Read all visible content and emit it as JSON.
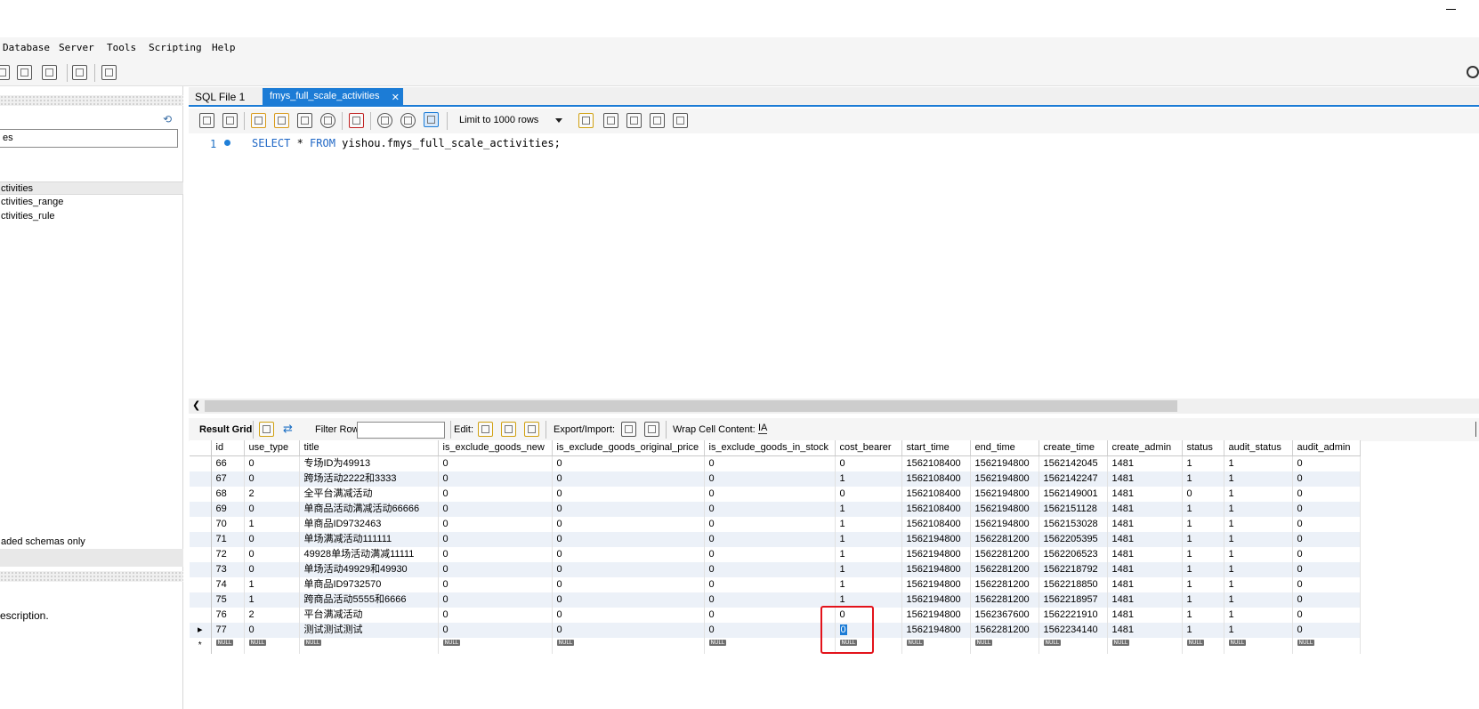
{
  "menu": [
    "Database",
    "Server",
    "Tools",
    "Scripting",
    "Help"
  ],
  "sidebar": {
    "filter_value": "es",
    "tables": [
      "ctivities",
      "ctivities_range",
      "ctivities_rule"
    ],
    "loaded_note": "aded schemas only",
    "description": "escription."
  },
  "tabs": [
    "SQL File 1",
    "fmys_full_scale_activities"
  ],
  "editor": {
    "line_number": "1",
    "sql_kw1": "SELECT",
    "sql_mid": " * ",
    "sql_kw2": "FROM",
    "sql_rest": " yishou.fmys_full_scale_activities;"
  },
  "toolbar": {
    "limit_label": "Limit to 1000 rows"
  },
  "result_toolbar": {
    "result_grid": "Result Grid",
    "filter_rows": "Filter Rows:",
    "edit": "Edit:",
    "export_import": "Export/Import:",
    "wrap": "Wrap Cell Content:"
  },
  "grid": {
    "columns": [
      "id",
      "use_type",
      "title",
      "is_exclude_goods_new",
      "is_exclude_goods_original_price",
      "is_exclude_goods_in_stock",
      "cost_bearer",
      "start_time",
      "end_time",
      "create_time",
      "create_admin",
      "status",
      "audit_status",
      "audit_admin"
    ],
    "rows": [
      [
        "66",
        "0",
        "专场ID为49913",
        "0",
        "0",
        "0",
        "0",
        "1562108400",
        "1562194800",
        "1562142045",
        "1481",
        "1",
        "1",
        "0"
      ],
      [
        "67",
        "0",
        "跨场活动2222和3333",
        "0",
        "0",
        "0",
        "1",
        "1562108400",
        "1562194800",
        "1562142247",
        "1481",
        "1",
        "1",
        "0"
      ],
      [
        "68",
        "2",
        "全平台满减活动",
        "0",
        "0",
        "0",
        "0",
        "1562108400",
        "1562194800",
        "1562149001",
        "1481",
        "0",
        "1",
        "0"
      ],
      [
        "69",
        "0",
        "单商品活动满减活动66666",
        "0",
        "0",
        "0",
        "1",
        "1562108400",
        "1562194800",
        "1562151128",
        "1481",
        "1",
        "1",
        "0"
      ],
      [
        "70",
        "1",
        "单商品ID9732463",
        "0",
        "0",
        "0",
        "1",
        "1562108400",
        "1562194800",
        "1562153028",
        "1481",
        "1",
        "1",
        "0"
      ],
      [
        "71",
        "0",
        "单场满减活动111111",
        "0",
        "0",
        "0",
        "1",
        "1562194800",
        "1562281200",
        "1562205395",
        "1481",
        "1",
        "1",
        "0"
      ],
      [
        "72",
        "0",
        "49928单场活动满减11111",
        "0",
        "0",
        "0",
        "1",
        "1562194800",
        "1562281200",
        "1562206523",
        "1481",
        "1",
        "1",
        "0"
      ],
      [
        "73",
        "0",
        "单场活动49929和49930",
        "0",
        "0",
        "0",
        "1",
        "1562194800",
        "1562281200",
        "1562218792",
        "1481",
        "1",
        "1",
        "0"
      ],
      [
        "74",
        "1",
        "单商品ID9732570",
        "0",
        "0",
        "0",
        "1",
        "1562194800",
        "1562281200",
        "1562218850",
        "1481",
        "1",
        "1",
        "0"
      ],
      [
        "75",
        "1",
        "跨商品活动5555和6666",
        "0",
        "0",
        "0",
        "1",
        "1562194800",
        "1562281200",
        "1562218957",
        "1481",
        "1",
        "1",
        "0"
      ],
      [
        "76",
        "2",
        "平台满减活动",
        "0",
        "0",
        "0",
        "0",
        "1562194800",
        "1562367600",
        "1562221910",
        "1481",
        "1",
        "1",
        "0"
      ],
      [
        "77",
        "0",
        "测试测试测试",
        "0",
        "0",
        "0",
        "0",
        "1562194800",
        "1562281200",
        "1562234140",
        "1481",
        "1",
        "1",
        "0"
      ]
    ],
    "null_label": "NULL",
    "new_row_marker": "*",
    "current_row_marker": "▸"
  }
}
